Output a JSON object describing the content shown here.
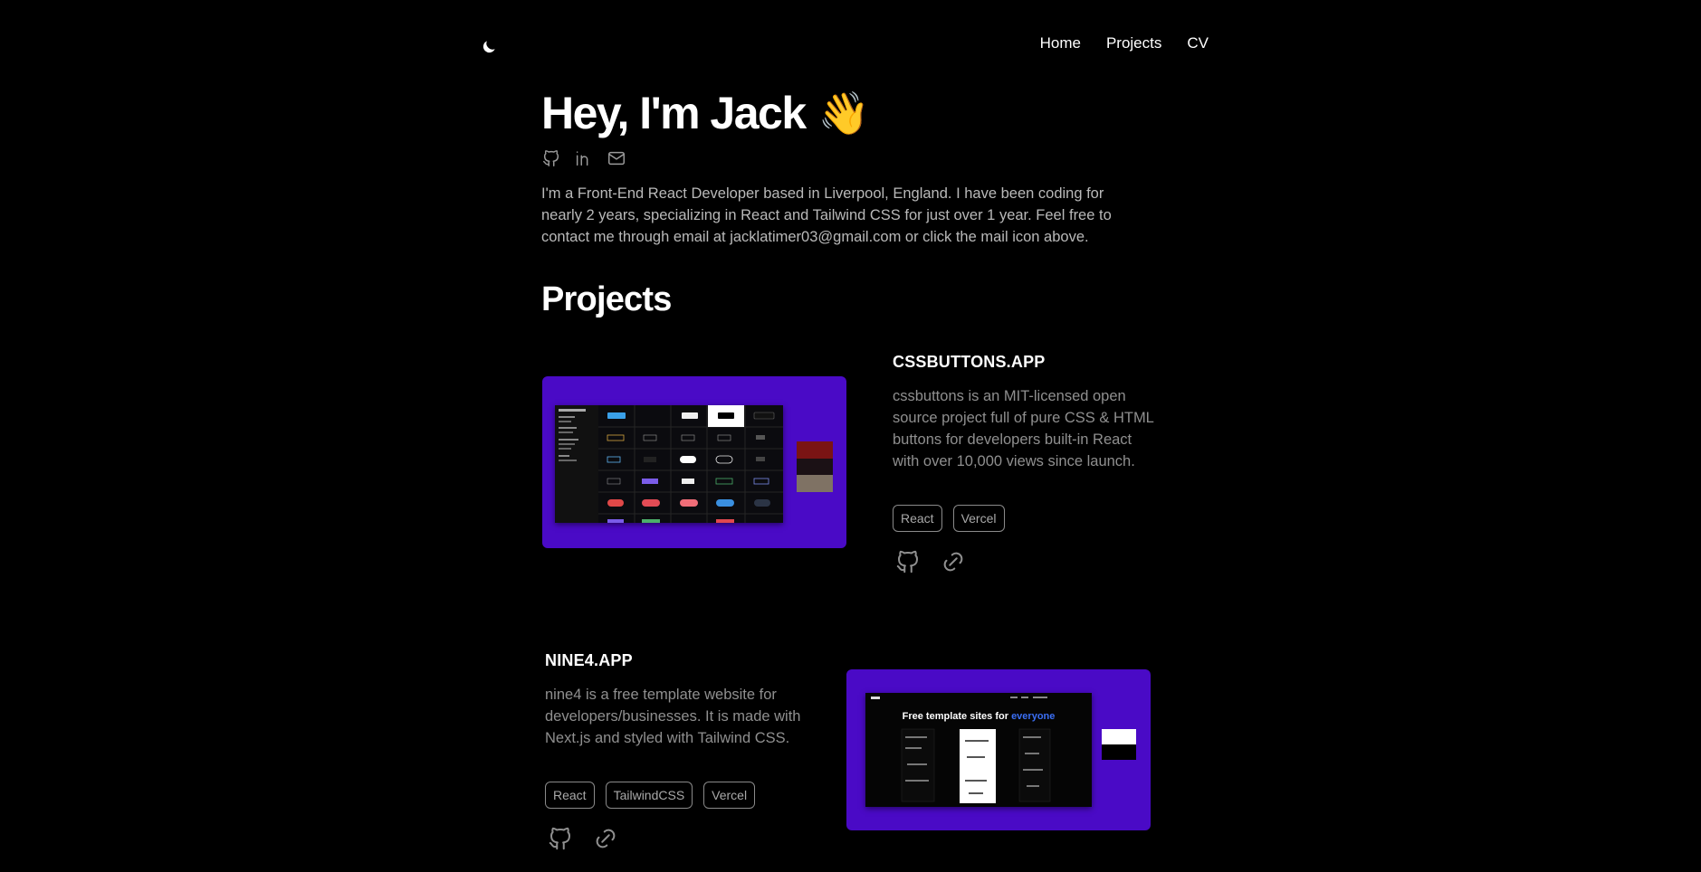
{
  "nav": {
    "theme_icon": "moon-icon",
    "links": [
      "Home",
      "Projects",
      "CV"
    ]
  },
  "hero": {
    "title": "Hey, I'm Jack",
    "emoji": "👋",
    "social_icons": [
      "github-icon",
      "linkedin-icon",
      "mail-icon"
    ],
    "bio": "I'm a Front-End React Developer based in Liverpool, England. I have been coding for nearly 2 years, specializing in React and Tailwind CSS for just over 1 year. Feel free to contact me through email at jacklatimer03@gmail.com or click the mail icon above."
  },
  "projects": {
    "heading": "Projects",
    "items": [
      {
        "title": "CSSBUTTONS.APP",
        "description": "cssbuttons is an MIT-licensed open source project full of pure CSS & HTML buttons for developers built-in React with over 10,000 views since launch.",
        "tags": [
          "React",
          "Vercel"
        ],
        "link_icons": [
          "github-icon",
          "link-icon"
        ],
        "swatches": [
          "#7a1414",
          "#1b1115",
          "#7f7264"
        ]
      },
      {
        "title": "NINE4.APP",
        "description": "nine4 is a free template website for developers/businesses. It is made with Next.js and styled with Tailwind CSS.",
        "tags": [
          "React",
          "TailwindCSS",
          "Vercel"
        ],
        "link_icons": [
          "github-icon",
          "link-icon"
        ],
        "screenshot_heading": "Free template sites for",
        "screenshot_highlight": "everyone",
        "swatches": [
          "#ffffff",
          "#000000"
        ]
      }
    ]
  },
  "colors": {
    "background": "#000000",
    "text": "#ffffff",
    "muted": "#b9b9b9",
    "thumbnail": "#4a0ac6"
  }
}
